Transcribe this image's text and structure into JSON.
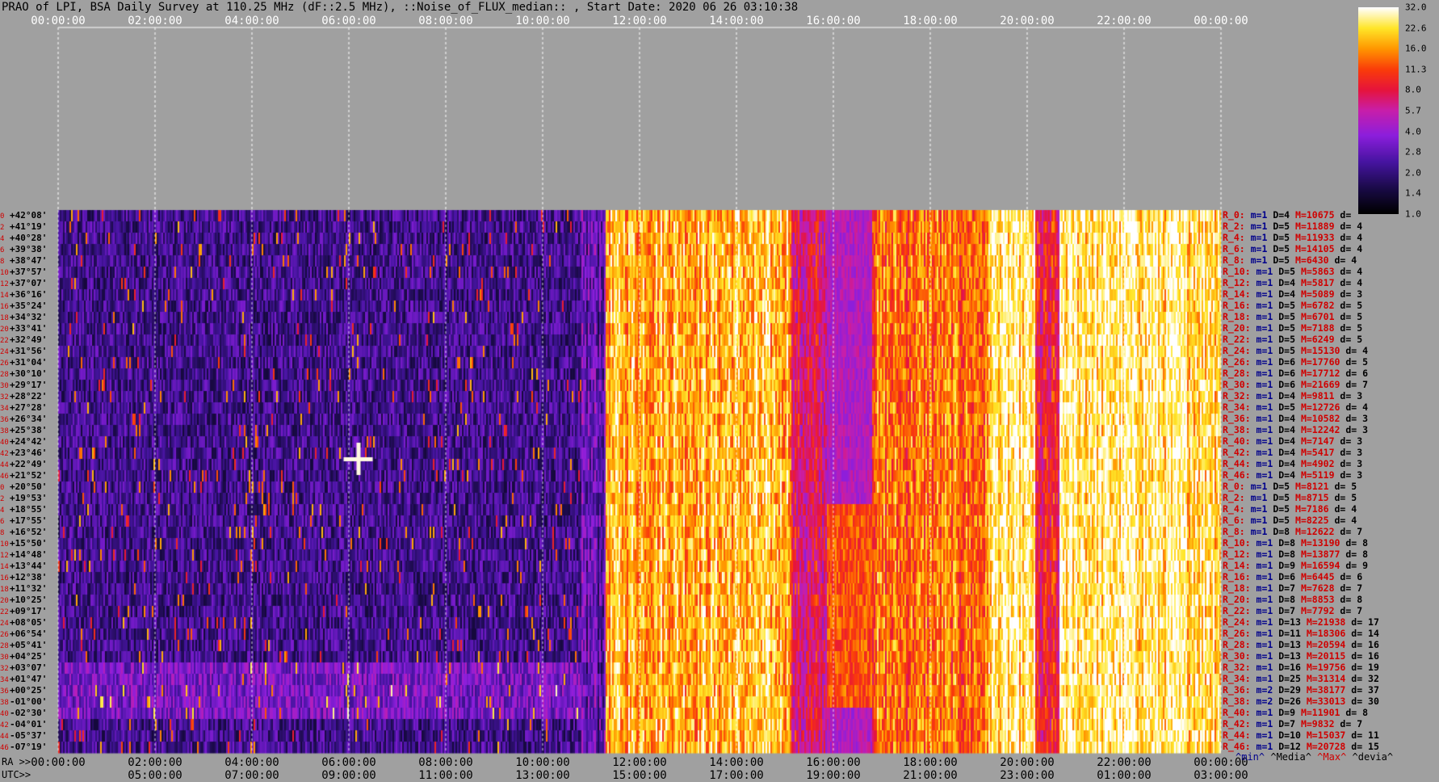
{
  "title": "PRAO of LPI, BSA Daily Survey at 110.25 MHz (dF::2.5 MHz), ::Noise_of_FLUX_median:: , Start Date: 2020 06 26 03:10:38",
  "top_ticks": [
    "00:00:00",
    "02:00:00",
    "04:00:00",
    "06:00:00",
    "08:00:00",
    "10:00:00",
    "12:00:00",
    "14:00:00",
    "16:00:00",
    "18:00:00",
    "20:00:00",
    "22:00:00",
    "00:00:00"
  ],
  "ra_prefix": "RA >>",
  "utc_prefix": "UTC>>",
  "bottom_ra_ticks": [
    "00:00:00",
    "02:00:00",
    "04:00:00",
    "06:00:00",
    "08:00:00",
    "10:00:00",
    "12:00:00",
    "14:00:00",
    "16:00:00",
    "18:00:00",
    "20:00:00",
    "22:00:00",
    "00:00:00"
  ],
  "bottom_utc_ticks": [
    "05:00:00",
    "07:00:00",
    "09:00:00",
    "11:00:00",
    "13:00:00",
    "15:00:00",
    "17:00:00",
    "19:00:00",
    "21:00:00",
    "23:00:00",
    "01:00:00",
    "03:00:00"
  ],
  "dec_labels": [
    {
      "i": "0",
      "d": "+42°08'"
    },
    {
      "i": "2",
      "d": "+41°19'"
    },
    {
      "i": "4",
      "d": "+40°28'"
    },
    {
      "i": "6",
      "d": "+39°38'"
    },
    {
      "i": "8",
      "d": "+38°47'"
    },
    {
      "i": "10",
      "d": "+37°57'"
    },
    {
      "i": "12",
      "d": "+37°07'"
    },
    {
      "i": "14",
      "d": "+36°16'"
    },
    {
      "i": "16",
      "d": "+35°24'"
    },
    {
      "i": "18",
      "d": "+34°32'"
    },
    {
      "i": "20",
      "d": "+33°41'"
    },
    {
      "i": "22",
      "d": "+32°49'"
    },
    {
      "i": "24",
      "d": "+31°56'"
    },
    {
      "i": "26",
      "d": "+31°04'"
    },
    {
      "i": "28",
      "d": "+30°10'"
    },
    {
      "i": "30",
      "d": "+29°17'"
    },
    {
      "i": "32",
      "d": "+28°22'"
    },
    {
      "i": "34",
      "d": "+27°28'"
    },
    {
      "i": "36",
      "d": "+26°34'"
    },
    {
      "i": "38",
      "d": "+25°38'"
    },
    {
      "i": "40",
      "d": "+24°42'"
    },
    {
      "i": "42",
      "d": "+23°46'"
    },
    {
      "i": "44",
      "d": "+22°49'"
    },
    {
      "i": "46",
      "d": "+21°52'"
    },
    {
      "i": "0",
      "d": "+20°50'"
    },
    {
      "i": "2",
      "d": "+19°53'"
    },
    {
      "i": "4",
      "d": "+18°55'"
    },
    {
      "i": "6",
      "d": "+17°55'"
    },
    {
      "i": "8",
      "d": "+16°52'"
    },
    {
      "i": "10",
      "d": "+15°50'"
    },
    {
      "i": "12",
      "d": "+14°48'"
    },
    {
      "i": "14",
      "d": "+13°44'"
    },
    {
      "i": "16",
      "d": "+12°38'"
    },
    {
      "i": "18",
      "d": "+11°32'"
    },
    {
      "i": "20",
      "d": "+10°25'"
    },
    {
      "i": "22",
      "d": "+09°17'"
    },
    {
      "i": "24",
      "d": "+08°05'"
    },
    {
      "i": "26",
      "d": "+06°54'"
    },
    {
      "i": "28",
      "d": "+05°41'"
    },
    {
      "i": "30",
      "d": "+04°25'"
    },
    {
      "i": "32",
      "d": "+03°07'"
    },
    {
      "i": "34",
      "d": "+01°47'"
    },
    {
      "i": "36",
      "d": "+00°25'"
    },
    {
      "i": "38",
      "d": "-01°00'"
    },
    {
      "i": "40",
      "d": "-02°30'"
    },
    {
      "i": "42",
      "d": "-04°01'"
    },
    {
      "i": "44",
      "d": "-05°37'"
    },
    {
      "i": "46",
      "d": "-07°19'"
    }
  ],
  "stats": [
    {
      "r": "R_0:",
      "m": "m=1",
      "D": "D=4",
      "M": "M=10675",
      "d": "d="
    },
    {
      "r": "R_2:",
      "m": "m=1",
      "D": "D=5",
      "M": "M=11889",
      "d": "d= 4"
    },
    {
      "r": "R_4:",
      "m": "m=1",
      "D": "D=5",
      "M": "M=11933",
      "d": "d= 4"
    },
    {
      "r": "R_6:",
      "m": "m=1",
      "D": "D=5",
      "M": "M=14105",
      "d": "d= 4"
    },
    {
      "r": "R_8:",
      "m": "m=1",
      "D": "D=5",
      "M": "M=6430",
      "d": "d= 4"
    },
    {
      "r": "R_10:",
      "m": "m=1",
      "D": "D=5",
      "M": "M=5863",
      "d": "d= 4"
    },
    {
      "r": "R_12:",
      "m": "m=1",
      "D": "D=4",
      "M": "M=5817",
      "d": "d= 4"
    },
    {
      "r": "R_14:",
      "m": "m=1",
      "D": "D=4",
      "M": "M=5089",
      "d": "d= 3"
    },
    {
      "r": "R_16:",
      "m": "m=1",
      "D": "D=5",
      "M": "M=6782",
      "d": "d= 5"
    },
    {
      "r": "R_18:",
      "m": "m=1",
      "D": "D=5",
      "M": "M=6701",
      "d": "d= 5"
    },
    {
      "r": "R_20:",
      "m": "m=1",
      "D": "D=5",
      "M": "M=7188",
      "d": "d= 5"
    },
    {
      "r": "R_22:",
      "m": "m=1",
      "D": "D=5",
      "M": "M=6249",
      "d": "d= 5"
    },
    {
      "r": "R_24:",
      "m": "m=1",
      "D": "D=5",
      "M": "M=15130",
      "d": "d= 4"
    },
    {
      "r": "R_26:",
      "m": "m=1",
      "D": "D=6",
      "M": "M=17760",
      "d": "d= 5"
    },
    {
      "r": "R_28:",
      "m": "m=1",
      "D": "D=6",
      "M": "M=17712",
      "d": "d= 6"
    },
    {
      "r": "R_30:",
      "m": "m=1",
      "D": "D=6",
      "M": "M=21669",
      "d": "d= 7"
    },
    {
      "r": "R_32:",
      "m": "m=1",
      "D": "D=4",
      "M": "M=9811",
      "d": "d= 3"
    },
    {
      "r": "R_34:",
      "m": "m=1",
      "D": "D=5",
      "M": "M=12726",
      "d": "d= 4"
    },
    {
      "r": "R_36:",
      "m": "m=1",
      "D": "D=4",
      "M": "M=10582",
      "d": "d= 3"
    },
    {
      "r": "R_38:",
      "m": "m=1",
      "D": "D=4",
      "M": "M=12242",
      "d": "d= 3"
    },
    {
      "r": "R_40:",
      "m": "m=1",
      "D": "D=4",
      "M": "M=7147",
      "d": "d= 3"
    },
    {
      "r": "R_42:",
      "m": "m=1",
      "D": "D=4",
      "M": "M=5417",
      "d": "d= 3"
    },
    {
      "r": "R_44:",
      "m": "m=1",
      "D": "D=4",
      "M": "M=4902",
      "d": "d= 3"
    },
    {
      "r": "R_46:",
      "m": "m=1",
      "D": "D=4",
      "M": "M=5119",
      "d": "d= 3"
    },
    {
      "r": "R_0:",
      "m": "m=1",
      "D": "D=5",
      "M": "M=8121",
      "d": "d= 5"
    },
    {
      "r": "R_2:",
      "m": "m=1",
      "D": "D=5",
      "M": "M=8715",
      "d": "d= 5"
    },
    {
      "r": "R_4:",
      "m": "m=1",
      "D": "D=5",
      "M": "M=7186",
      "d": "d= 4"
    },
    {
      "r": "R_6:",
      "m": "m=1",
      "D": "D=5",
      "M": "M=8225",
      "d": "d= 4"
    },
    {
      "r": "R_8:",
      "m": "m=1",
      "D": "D=8",
      "M": "M=12622",
      "d": "d= 7"
    },
    {
      "r": "R_10:",
      "m": "m=1",
      "D": "D=8",
      "M": "M=13190",
      "d": "d= 8"
    },
    {
      "r": "R_12:",
      "m": "m=1",
      "D": "D=8",
      "M": "M=13877",
      "d": "d= 8"
    },
    {
      "r": "R_14:",
      "m": "m=1",
      "D": "D=9",
      "M": "M=16594",
      "d": "d= 9"
    },
    {
      "r": "R_16:",
      "m": "m=1",
      "D": "D=6",
      "M": "M=6445",
      "d": "d= 6"
    },
    {
      "r": "R_18:",
      "m": "m=1",
      "D": "D=7",
      "M": "M=7628",
      "d": "d= 7"
    },
    {
      "r": "R_20:",
      "m": "m=1",
      "D": "D=8",
      "M": "M=8853",
      "d": "d= 8"
    },
    {
      "r": "R_22:",
      "m": "m=1",
      "D": "D=7",
      "M": "M=7792",
      "d": "d= 7"
    },
    {
      "r": "R_24:",
      "m": "m=1",
      "D": "D=13",
      "M": "M=21938",
      "d": "d= 17"
    },
    {
      "r": "R_26:",
      "m": "m=1",
      "D": "D=11",
      "M": "M=18306",
      "d": "d= 14"
    },
    {
      "r": "R_28:",
      "m": "m=1",
      "D": "D=13",
      "M": "M=20594",
      "d": "d= 16"
    },
    {
      "r": "R_30:",
      "m": "m=1",
      "D": "D=13",
      "M": "M=20115",
      "d": "d= 16"
    },
    {
      "r": "R_32:",
      "m": "m=1",
      "D": "D=16",
      "M": "M=19756",
      "d": "d= 19"
    },
    {
      "r": "R_34:",
      "m": "m=1",
      "D": "D=25",
      "M": "M=31314",
      "d": "d= 32"
    },
    {
      "r": "R_36:",
      "m": "m=2",
      "D": "D=29",
      "M": "M=38177",
      "d": "d= 37"
    },
    {
      "r": "R_38:",
      "m": "m=2",
      "D": "D=26",
      "M": "M=33013",
      "d": "d= 30"
    },
    {
      "r": "R_40:",
      "m": "m=1",
      "D": "D=9",
      "M": "M=11901",
      "d": "d= 8"
    },
    {
      "r": "R_42:",
      "m": "m=1",
      "D": "D=7",
      "M": "M=9832",
      "d": "d= 7"
    },
    {
      "r": "R_44:",
      "m": "m=1",
      "D": "D=10",
      "M": "M=15037",
      "d": "d= 11"
    },
    {
      "r": "R_46:",
      "m": "m=1",
      "D": "D=12",
      "M": "M=20728",
      "d": "d= 15"
    }
  ],
  "legend_footer": {
    "min": "^min^",
    "media": "^Media^",
    "max": "^Max^",
    "devia": "^devia^"
  },
  "colorbar_labels": [
    "32.0",
    "22.6",
    "16.0",
    "11.3",
    "8.0",
    "5.7",
    "4.0",
    "2.8",
    "2.0",
    "1.4",
    "1.0"
  ],
  "colors": {
    "background": "#a0a0a0",
    "dark": "#0a0520",
    "purple": "#5a1ab0",
    "magenta": "#c018b0",
    "red": "#e01010",
    "orange": "#ff8000",
    "yellow": "#ffe030",
    "white": "#ffffff"
  },
  "chart_data": {
    "type": "heatmap",
    "title": "PRAO of LPI, BSA Daily Survey at 110.25 MHz (dF::2.5 MHz), ::Noise_of_FLUX_median:: , Start Date: 2020 06 26 03:10:38",
    "xlabel": "RA",
    "x_range_hours": [
      0,
      24
    ],
    "n_rows": 48,
    "colorbar_range": [
      1.0,
      32.0
    ],
    "colorbar_scale": "log2"
  }
}
